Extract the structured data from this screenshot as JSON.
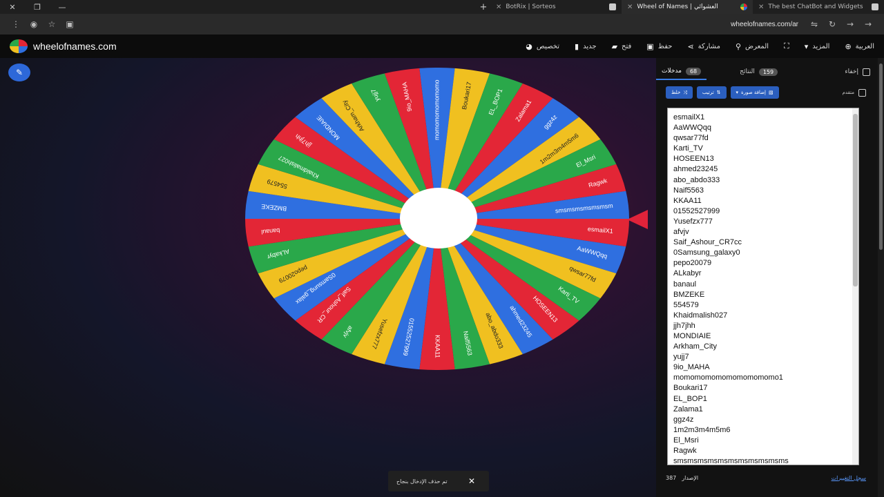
{
  "browser": {
    "tabs": [
      {
        "label": "BotRix | Sorteos",
        "active": false
      },
      {
        "label": "Wheel of Names | العشوائي",
        "active": true
      },
      {
        "label": "The best ChatBot and Widgets",
        "active": false
      }
    ],
    "url": "wheelofnames.com/ar"
  },
  "app": {
    "logo": "wheelofnames.com",
    "menu": [
      {
        "label": "تخصيص",
        "icon": "palette-icon"
      },
      {
        "label": "جديد",
        "icon": "file-icon"
      },
      {
        "label": "فتح",
        "icon": "folder-icon"
      },
      {
        "label": "حفظ",
        "icon": "save-icon"
      },
      {
        "label": "مشاركة",
        "icon": "share-icon"
      },
      {
        "label": "المعرض",
        "icon": "search-icon"
      },
      {
        "label": "",
        "icon": "fullscreen-icon"
      },
      {
        "label": "المزيد",
        "icon": "chevron-down-icon"
      },
      {
        "label": "العربية",
        "icon": "globe-icon"
      }
    ]
  },
  "panel": {
    "hide_label": "إخفاء",
    "results_label": "النتائج",
    "results_count": "159",
    "entries_label": "مدخلات",
    "entries_count": "68",
    "shuffle_label": "خلط",
    "sort_label": "ترتيب",
    "add_image_label": "إضافة صورة",
    "advanced_label": "متقدم",
    "entries": [
      "esmailX1",
      "AaWWQqq",
      "qwsar77fd",
      "Karti_TV",
      "HOSEEN13",
      "ahmed23245",
      "abo_abdo333",
      "Naif5563",
      "KKAA11",
      "01552527999",
      "Yusefzx777",
      "afvjv",
      "Saif_Ashour_CR7cc",
      "0Samsung_galaxy0",
      "pepo20079",
      "ALkabyr",
      "banaul",
      "BMZEKE",
      "554579",
      "Khaidmalish027",
      "jjh7jhh",
      "MONDIAIE",
      "Arkham_City",
      "yujj7",
      "9io_MAHA",
      "momomomomomomomomomo1",
      "Boukari17",
      "EL_BOP1",
      "Zalama1",
      "ggz4z",
      "1m2m3m4m5m6",
      "El_Msri",
      "Ragwk",
      "smsmsmsmsmsmsmsmsmsmsms"
    ],
    "changelog_label": "سجل التغييرات",
    "version_label": "الإصدار",
    "version_number": "387"
  },
  "wheel": {
    "slice_colors": [
      "#e32636",
      "#2f6fe0",
      "#f0c020",
      "#2aa84a"
    ],
    "highlight": "MONDIAIE"
  },
  "toast": {
    "message": "تم حذف الإدخال بنجاح"
  }
}
